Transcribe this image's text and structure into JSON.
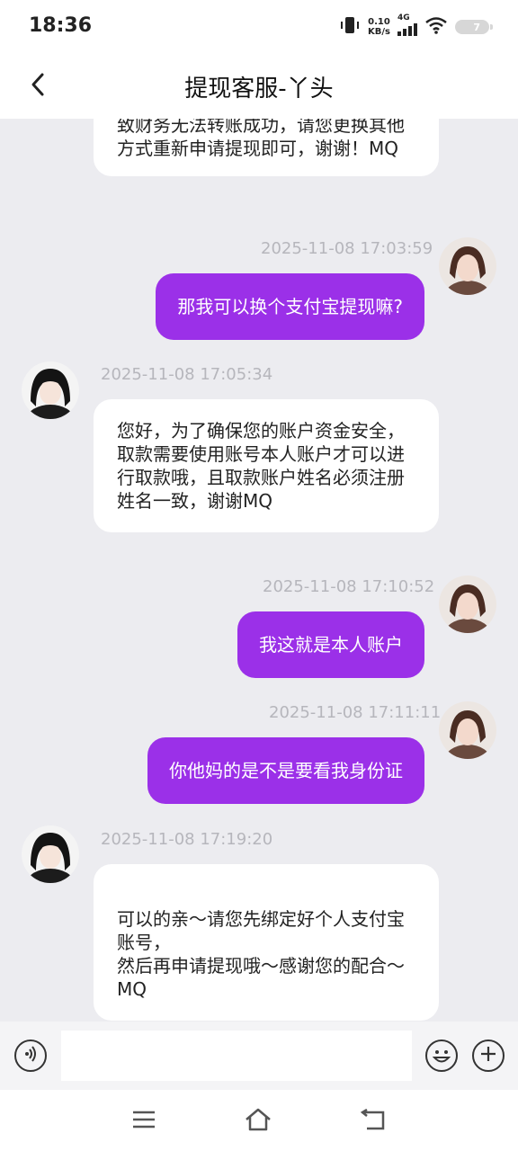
{
  "status_bar": {
    "time": "18:36",
    "net_speed_value": "0.10",
    "net_speed_unit": "KB/s",
    "network_type": "4G",
    "battery_level": "7"
  },
  "header": {
    "title": "提现客服-丫头",
    "back_icon": "chevron-left-icon"
  },
  "messages": [
    {
      "side": "agent",
      "text": "致财务无法转账成功，请您更换其他方式重新申请提现即可，谢谢！MQ"
    },
    {
      "side": "user",
      "timestamp": "2025-11-08 17:03:59",
      "text": "那我可以换个支付宝提现嘛?"
    },
    {
      "side": "agent",
      "timestamp": "2025-11-08 17:05:34",
      "text": "您好，为了确保您的账户资金安全，取款需要使用账号本人账户才可以进行取款哦，且取款账户姓名必须注册姓名一致，谢谢MQ"
    },
    {
      "side": "user",
      "timestamp": "2025-11-08 17:10:52",
      "text": "我这就是本人账户"
    },
    {
      "side": "user",
      "timestamp": "2025-11-08 17:11:11",
      "text": "你他妈的是不是要看我身份证"
    },
    {
      "side": "agent",
      "timestamp": "2025-11-08 17:19:20",
      "text": "可以的亲～请您先绑定好个人支付宝账号，\n然后再申请提现哦～感谢您的配合～MQ"
    }
  ],
  "input_bar": {
    "placeholder": "",
    "voice_icon": "voice-icon",
    "emoji_icon": "emoji-icon",
    "plus_icon": "plus-icon"
  },
  "colors": {
    "user_bubble": "#9b30e8",
    "agent_bubble": "#ffffff",
    "chat_background": "#ececf0"
  }
}
